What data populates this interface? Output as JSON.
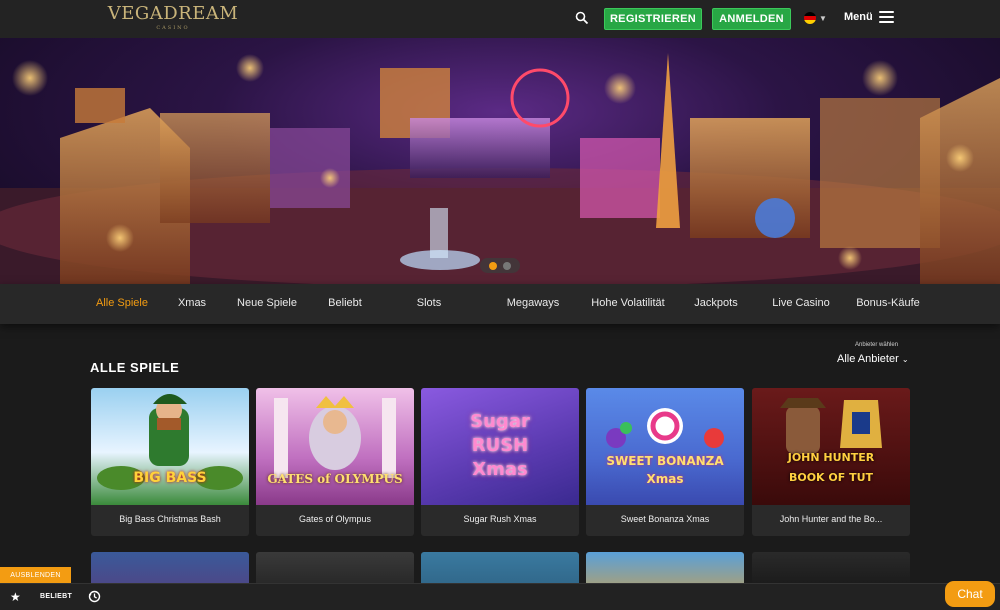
{
  "header": {
    "logo_text": "VEGADREAM",
    "logo_sub": "CASINO",
    "register_label": "REGISTRIEREN",
    "login_label": "ANMELDEN",
    "menu_label": "Menü",
    "icons": [
      "search-icon",
      "flag-de-icon",
      "chevron-down-icon",
      "hamburger-icon"
    ]
  },
  "hero": {
    "slide_count": 2,
    "active_slide": 1
  },
  "categories": [
    {
      "label": "Alle Spiele",
      "active": true
    },
    {
      "label": "Xmas"
    },
    {
      "label": "Neue Spiele"
    },
    {
      "label": "Beliebt"
    },
    {
      "label": "Slots"
    },
    {
      "label": "Megaways"
    },
    {
      "label": "Hohe Volatilität"
    },
    {
      "label": "Jackpots"
    },
    {
      "label": "Live Casino"
    },
    {
      "label": "Bonus-Käufe"
    }
  ],
  "section": {
    "title": "ALLE SPIELE",
    "provider_label": "Anbieter wählen",
    "provider_value": "Alle Anbieter"
  },
  "games": [
    {
      "name": "Big Bass Christmas Bash",
      "art": "BIG BASS"
    },
    {
      "name": "Gates of Olympus",
      "art": "GATES of OLYMPUS"
    },
    {
      "name": "Sugar Rush Xmas",
      "art": "Sugar RUSH Xmas"
    },
    {
      "name": "Sweet Bonanza Xmas",
      "art": "SWEET BONANZA Xmas"
    },
    {
      "name": "John Hunter and the Bo...",
      "art": "JOHN HUNTER BOOK OF TUT"
    }
  ],
  "footer": {
    "hide_label": "AUSBLENDEN",
    "beliebt_label": "BELIEBT",
    "chat_label": "Chat"
  },
  "colors": {
    "accent": "#f39c12",
    "green": "#28a745",
    "background": "#1b1b1b"
  }
}
